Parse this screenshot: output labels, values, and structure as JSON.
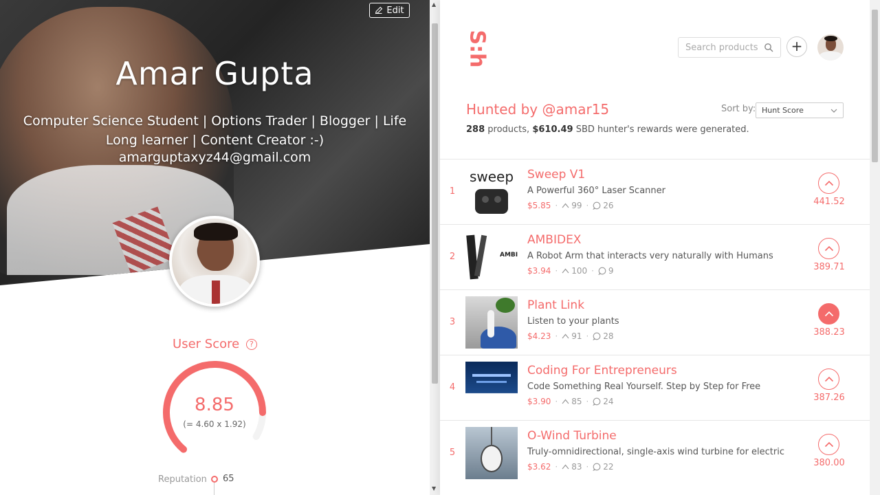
{
  "profile": {
    "edit_label": "Edit",
    "name": "Amar Gupta",
    "bio": "Computer Science Student | Options Trader | Blogger | Life Long learner | Content Creator :-)",
    "email": "amarguptaxyz44@gmail.com",
    "user_score_label": "User Score",
    "score": "8.85",
    "score_formula": "(= 4.60 x 1.92)",
    "score_fraction": 0.885,
    "reputation_label": "Reputation",
    "reputation_value": "65"
  },
  "header": {
    "logo": "S:h",
    "search_placeholder": "Search products"
  },
  "hunted": {
    "title": "Hunted by @amar15",
    "product_count": "288",
    "products_word": "products,",
    "rewards": "$610.49",
    "rewards_suffix": "SBD hunter's rewards were generated.",
    "sort_label": "Sort by:",
    "sort_value": "Hunt Score"
  },
  "products": [
    {
      "rank": "1",
      "name": "Sweep V1",
      "tagline": "A Powerful 360° Laser Scanner",
      "reward": "$5.85",
      "votes": "99",
      "comments": "26",
      "score": "441.52",
      "voted": false,
      "thumb_text": "sweep"
    },
    {
      "rank": "2",
      "name": "AMBIDEX",
      "tagline": "A Robot Arm that interacts very naturally with Humans",
      "reward": "$3.94",
      "votes": "100",
      "comments": "9",
      "score": "389.71",
      "voted": false,
      "thumb_text": "AMBI"
    },
    {
      "rank": "3",
      "name": "Plant Link",
      "tagline": "Listen to your plants",
      "reward": "$4.23",
      "votes": "91",
      "comments": "28",
      "score": "388.23",
      "voted": true,
      "thumb_text": ""
    },
    {
      "rank": "4",
      "name": "Coding For Entrepreneurs",
      "tagline": "Code Something Real Yourself. Step by Step for Free",
      "reward": "$3.90",
      "votes": "85",
      "comments": "24",
      "score": "387.26",
      "voted": false,
      "thumb_text": ""
    },
    {
      "rank": "5",
      "name": "O-Wind Turbine",
      "tagline": "Truly-omnidirectional, single-axis wind turbine for electric",
      "reward": "$3.62",
      "votes": "83",
      "comments": "22",
      "score": "380.00",
      "voted": false,
      "thumb_text": ""
    }
  ],
  "colors": {
    "accent": "#f46b6b"
  }
}
